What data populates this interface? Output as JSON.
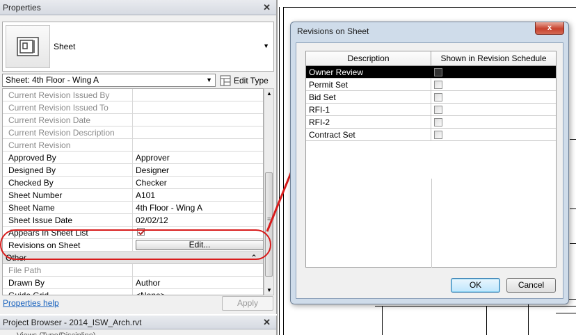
{
  "properties": {
    "title": "Properties",
    "close": "✕",
    "type_name": "Sheet",
    "instance_label": "Sheet: 4th Floor - Wing A",
    "edit_type": "Edit Type",
    "rows": [
      {
        "name": "Current Revision Issued By",
        "value": "",
        "readonly": true
      },
      {
        "name": "Current Revision Issued To",
        "value": "",
        "readonly": true
      },
      {
        "name": "Current Revision Date",
        "value": "",
        "readonly": true
      },
      {
        "name": "Current Revision Description",
        "value": "",
        "readonly": true
      },
      {
        "name": "Current Revision",
        "value": "",
        "readonly": true
      },
      {
        "name": "Approved By",
        "value": "Approver",
        "readonly": false
      },
      {
        "name": "Designed By",
        "value": "Designer",
        "readonly": false
      },
      {
        "name": "Checked By",
        "value": "Checker",
        "readonly": false
      },
      {
        "name": "Sheet Number",
        "value": "A101",
        "readonly": false
      },
      {
        "name": "Sheet Name",
        "value": "4th Floor - Wing A",
        "readonly": false
      },
      {
        "name": "Sheet Issue Date",
        "value": "02/02/12",
        "readonly": false
      }
    ],
    "appears_in_sheet_list": "Appears In Sheet List",
    "revisions_on_sheet": "Revisions on Sheet",
    "edit_button": "Edit...",
    "group_other": "Other",
    "group_other_toggle": "⌃",
    "rows_other": [
      {
        "name": "File Path",
        "value": ""
      },
      {
        "name": "Drawn By",
        "value": "Author"
      },
      {
        "name": "Guide Grid",
        "value": "<None>"
      }
    ],
    "help_link": "Properties help",
    "apply": "Apply"
  },
  "project_browser": {
    "title": "Project Browser - 2014_ISW_Arch.rvt",
    "close": "✕",
    "first_item": "Views (Type/Discipline)"
  },
  "dialog": {
    "title": "Revisions on Sheet",
    "close": "x",
    "columns": [
      "Description",
      "Shown in Revision Schedule"
    ],
    "rows": [
      {
        "description": "Owner Review",
        "shown": false,
        "selected": true
      },
      {
        "description": "Permit Set",
        "shown": false,
        "selected": false
      },
      {
        "description": "Bid Set",
        "shown": false,
        "selected": false
      },
      {
        "description": "RFI-1",
        "shown": false,
        "selected": false
      },
      {
        "description": "RFI-2",
        "shown": false,
        "selected": false
      },
      {
        "description": "Contract Set",
        "shown": false,
        "selected": false
      }
    ],
    "ok": "OK",
    "cancel": "Cancel"
  },
  "colors": {
    "annotation_red": "#d81b1b",
    "selection": "#000000",
    "link": "#1560bd"
  }
}
